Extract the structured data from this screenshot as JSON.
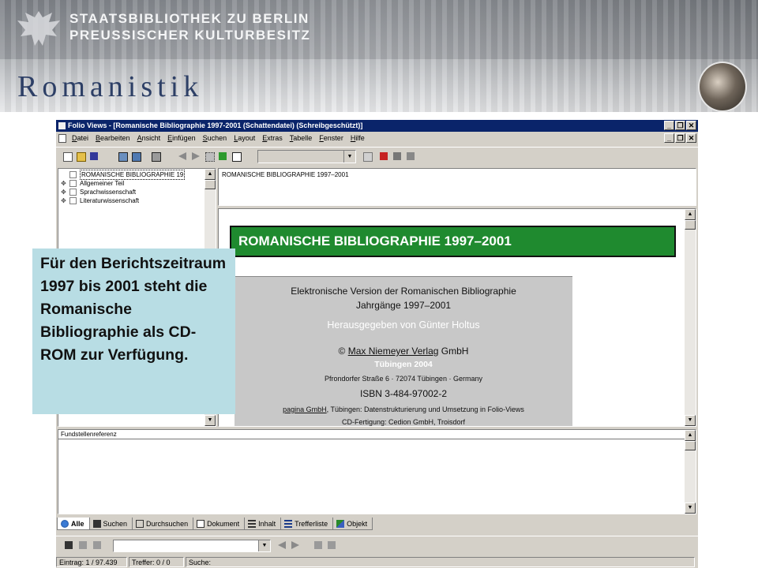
{
  "banner": {
    "library_line1": "STAATSBIBLIOTHEK ZU BERLIN",
    "library_line2": "PREUSSISCHER KULTURBESITZ",
    "section_title": "Romanistik"
  },
  "window": {
    "title": "Folio Views - [Romanische Bibliographie 1997-2001 (Schattendatei)  (Schreibgeschützt)]",
    "buttons": {
      "minimize": "_",
      "restore": "❐",
      "close": "✕"
    }
  },
  "menu": [
    "Datei",
    "Bearbeiten",
    "Ansicht",
    "Einfügen",
    "Suchen",
    "Layout",
    "Extras",
    "Tabelle",
    "Fenster",
    "Hilfe"
  ],
  "tree": {
    "items": [
      {
        "label": "ROMANISCHE BIBLIOGRAPHIE 19",
        "expander": "",
        "selected": true
      },
      {
        "label": "Allgemeiner Teil",
        "expander": "✥",
        "selected": false
      },
      {
        "label": "Sprachwissenschaft",
        "expander": "✥",
        "selected": false
      },
      {
        "label": "Literaturwissenschaft",
        "expander": "✥",
        "selected": false
      }
    ]
  },
  "header_pane": {
    "text": "ROMANISCHE BIBLIOGRAPHIE 1997–2001"
  },
  "document": {
    "banner_title": "ROMANISCHE BIBLIOGRAPHIE 1997–2001",
    "line1": "Elektronische Version der Romanischen Bibliographie",
    "line2": "Jahrgänge 1997–2001",
    "line3": "Herausgegeben von Günter Holtus",
    "copyright_symbol": "©",
    "publisher": "Max Niemeyer Verlag",
    "publisher_suffix": " GmbH",
    "city_year": "Tübingen 2004",
    "address": "Pfrondorfer Straße 6 · 72074 Tübingen · Germany",
    "isbn": "ISBN 3-484-97002-2",
    "pagina": "pagina GmbH",
    "pagina_suffix": ", Tübingen: Datenstrukturierung und Umsetzung in Folio-Views",
    "cd": "CD-Fertigung: Cedion GmbH, Troisdorf"
  },
  "reference_pane": {
    "title": "Fundstellenreferenz"
  },
  "tabs": [
    {
      "label": "Alle",
      "icon": "globe-icon",
      "active": true
    },
    {
      "label": "Suchen",
      "icon": "binoculars-icon",
      "active": false
    },
    {
      "label": "Durchsuchen",
      "icon": "book-icon",
      "active": false
    },
    {
      "label": "Dokument",
      "icon": "document-icon",
      "active": false
    },
    {
      "label": "Inhalt",
      "icon": "contents-icon",
      "active": false
    },
    {
      "label": "Trefferliste",
      "icon": "list-icon",
      "active": false
    },
    {
      "label": "Objekt",
      "icon": "object-icon",
      "active": false
    }
  ],
  "status": {
    "entry": "Eintrag: 1 / 97.439",
    "hits": "Treffer: 0 / 0",
    "search": "Suche:"
  },
  "callout": {
    "text": "Für den Berichtszeitraum 1997 bis 2001 steht die Romanische Bibliographie als CD-ROM zur Verfügung."
  },
  "colors": {
    "titlebar": "#0a246a",
    "green_banner": "#1f8a2f",
    "callout_bg": "#b8dde4",
    "window_face": "#d4d0c8"
  }
}
